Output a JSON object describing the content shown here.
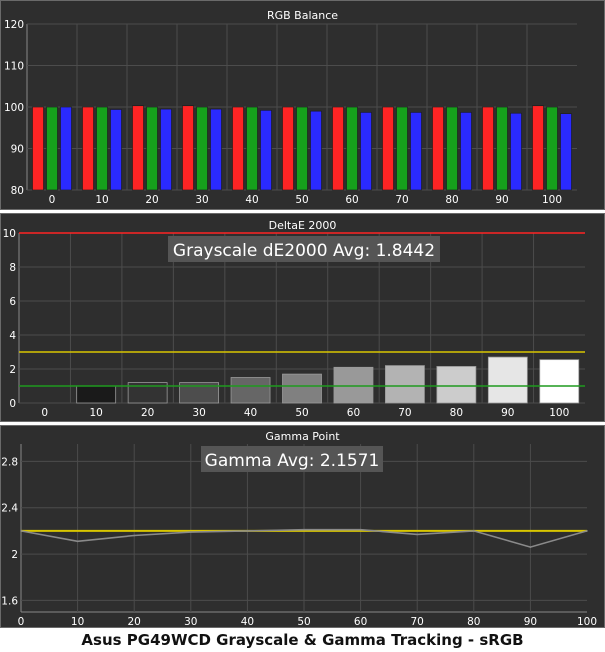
{
  "caption": "Asus PG49WCD Grayscale & Gamma Tracking - sRGB",
  "colors": {
    "background": "#2e2e2e",
    "panel_border": "#6a6a6a",
    "grid": "#4c4c4c",
    "text": "#ffffff",
    "red": "#ff2424",
    "green": "#16a11c",
    "blue": "#2a2aff",
    "yellow": "#d8c600",
    "green_line": "#1f9a1f",
    "gamma_line": "#8a8a8a"
  },
  "chart_data": [
    {
      "type": "bar",
      "title": "RGB Balance",
      "categories": [
        "0",
        "10",
        "20",
        "30",
        "40",
        "50",
        "60",
        "70",
        "80",
        "90",
        "100"
      ],
      "ylim": [
        80,
        120
      ],
      "yticks": [
        80,
        90,
        100,
        110,
        120
      ],
      "grid": true,
      "series": [
        {
          "color": "red",
          "values": [
            100,
            100,
            100.3,
            100.3,
            100,
            100,
            100,
            100,
            100,
            100,
            100.3
          ]
        },
        {
          "color": "green",
          "values": [
            100,
            100,
            100,
            100,
            100,
            100,
            100,
            100,
            100,
            100,
            100
          ]
        },
        {
          "color": "blue",
          "values": [
            100,
            99.4,
            99.5,
            99.5,
            99.2,
            99.0,
            98.7,
            98.7,
            98.7,
            98.5,
            98.4
          ]
        }
      ]
    },
    {
      "type": "bar",
      "title": "DeltaE 2000",
      "annotation": "Grayscale dE2000 Avg: 1.8442",
      "categories": [
        "0",
        "10",
        "20",
        "30",
        "40",
        "50",
        "60",
        "70",
        "80",
        "90",
        "100"
      ],
      "ylim": [
        0,
        10
      ],
      "yticks": [
        0,
        2,
        4,
        6,
        8,
        10
      ],
      "grid": true,
      "values": [
        0,
        1.0,
        1.2,
        1.2,
        1.5,
        1.7,
        2.1,
        2.2,
        2.15,
        2.7,
        2.55
      ],
      "bar_colors": [
        "#000000",
        "#1a1a1a",
        "#333333",
        "#4d4d4d",
        "#666666",
        "#808080",
        "#999999",
        "#b3b3b3",
        "#cccccc",
        "#e6e6e6",
        "#ffffff"
      ],
      "reference_lines": [
        {
          "value": 10,
          "color": "red"
        },
        {
          "value": 3,
          "color": "yellow"
        },
        {
          "value": 1,
          "color": "green"
        }
      ]
    },
    {
      "type": "line",
      "title": "Gamma Point",
      "annotation": "Gamma Avg: 2.1571",
      "x": [
        0,
        10,
        20,
        30,
        40,
        50,
        60,
        70,
        80,
        90,
        100
      ],
      "xticks": [
        0,
        10,
        20,
        30,
        40,
        50,
        60,
        70,
        80,
        90,
        100
      ],
      "xlim": [
        0,
        100
      ],
      "ylim": [
        1.5,
        2.95
      ],
      "yticks": [
        1.6,
        2.0,
        2.4,
        2.8
      ],
      "ytick_labels": [
        "1.6",
        "2",
        "2.4",
        "2.8"
      ],
      "grid": true,
      "target": 2.2,
      "values": [
        2.2,
        2.11,
        2.16,
        2.19,
        2.2,
        2.21,
        2.21,
        2.17,
        2.2,
        2.06,
        2.2
      ]
    }
  ]
}
